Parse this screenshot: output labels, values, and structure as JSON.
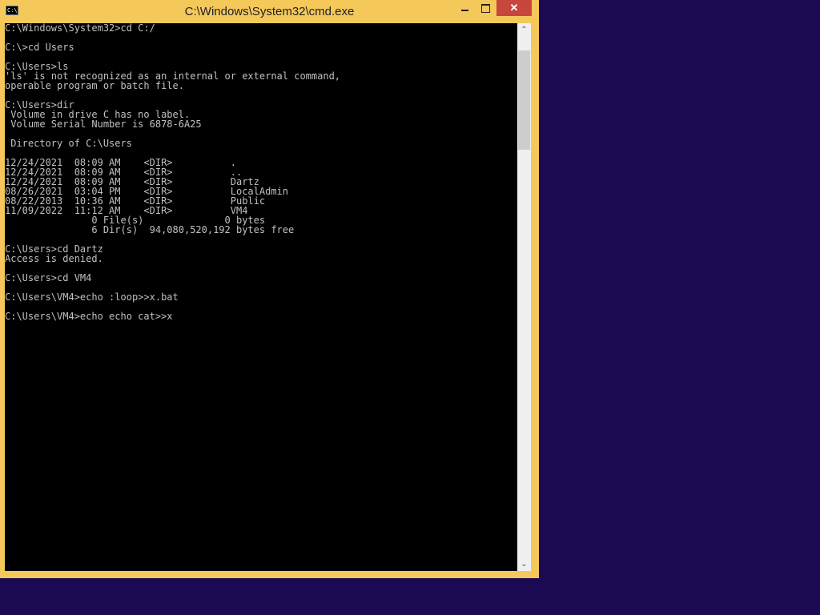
{
  "window": {
    "title": "C:\\Windows\\System32\\cmd.exe",
    "icon_text": "C:\\"
  },
  "controls": {
    "minimize_icon": "minimize-icon",
    "maximize_icon": "maximize-icon",
    "close_label": "✕"
  },
  "scrollbar": {
    "up_arrow": "⌃",
    "down_arrow": "⌄"
  },
  "console": {
    "lines": [
      "C:\\Windows\\System32>cd C:/",
      "",
      "C:\\>cd Users",
      "",
      "C:\\Users>ls",
      "'ls' is not recognized as an internal or external command,",
      "operable program or batch file.",
      "",
      "C:\\Users>dir",
      " Volume in drive C has no label.",
      " Volume Serial Number is 6878-6A25",
      "",
      " Directory of C:\\Users",
      "",
      "12/24/2021  08:09 AM    <DIR>          .",
      "12/24/2021  08:09 AM    <DIR>          ..",
      "12/24/2021  08:09 AM    <DIR>          Dartz",
      "08/26/2021  03:04 PM    <DIR>          LocalAdmin",
      "08/22/2013  10:36 AM    <DIR>          Public",
      "11/09/2022  11:12 AM    <DIR>          VM4",
      "               0 File(s)              0 bytes",
      "               6 Dir(s)  94,080,520,192 bytes free",
      "",
      "C:\\Users>cd Dartz",
      "Access is denied.",
      "",
      "C:\\Users>cd VM4",
      "",
      "C:\\Users\\VM4>echo :loop>>x.bat",
      "",
      "C:\\Users\\VM4>echo echo cat>>x"
    ]
  }
}
